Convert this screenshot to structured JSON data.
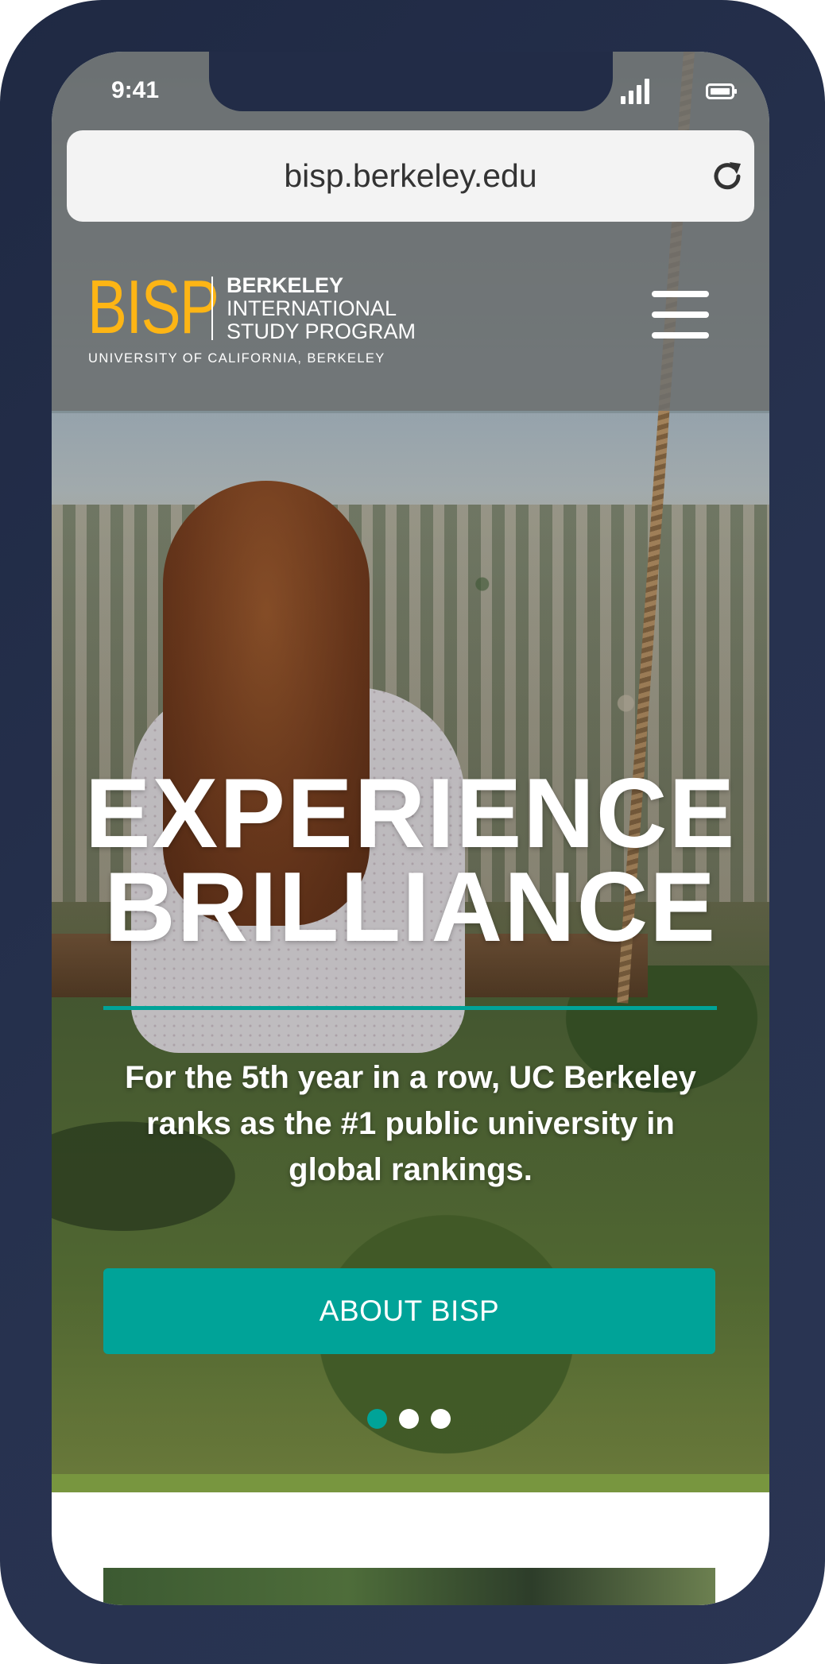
{
  "status_bar": {
    "time": "9:41",
    "signal_icon": "cellular-signal-icon",
    "battery_icon": "battery-icon"
  },
  "browser": {
    "url": "bisp.berkeley.edu",
    "reload_icon": "reload-icon"
  },
  "header": {
    "logo_mark": "BISP",
    "logo_line1": "BERKELEY",
    "logo_line2": "INTERNATIONAL",
    "logo_line3": "STUDY PROGRAM",
    "logo_subtitle": "UNIVERSITY OF CALIFORNIA, BERKELEY",
    "menu_icon": "hamburger-menu-icon"
  },
  "hero": {
    "headline_line1": "EXPERIENCE",
    "headline_line2": "BRILLIANCE",
    "subtext": "For the 5th year in a row, UC Berkeley ranks as the #1 public university in global rankings.",
    "cta_label": "ABOUT BISP",
    "carousel": {
      "total": 3,
      "active": 1
    }
  },
  "colors": {
    "accent_teal": "#00a398",
    "logo_gold": "#fdb515",
    "device_navy": "#222c47"
  }
}
